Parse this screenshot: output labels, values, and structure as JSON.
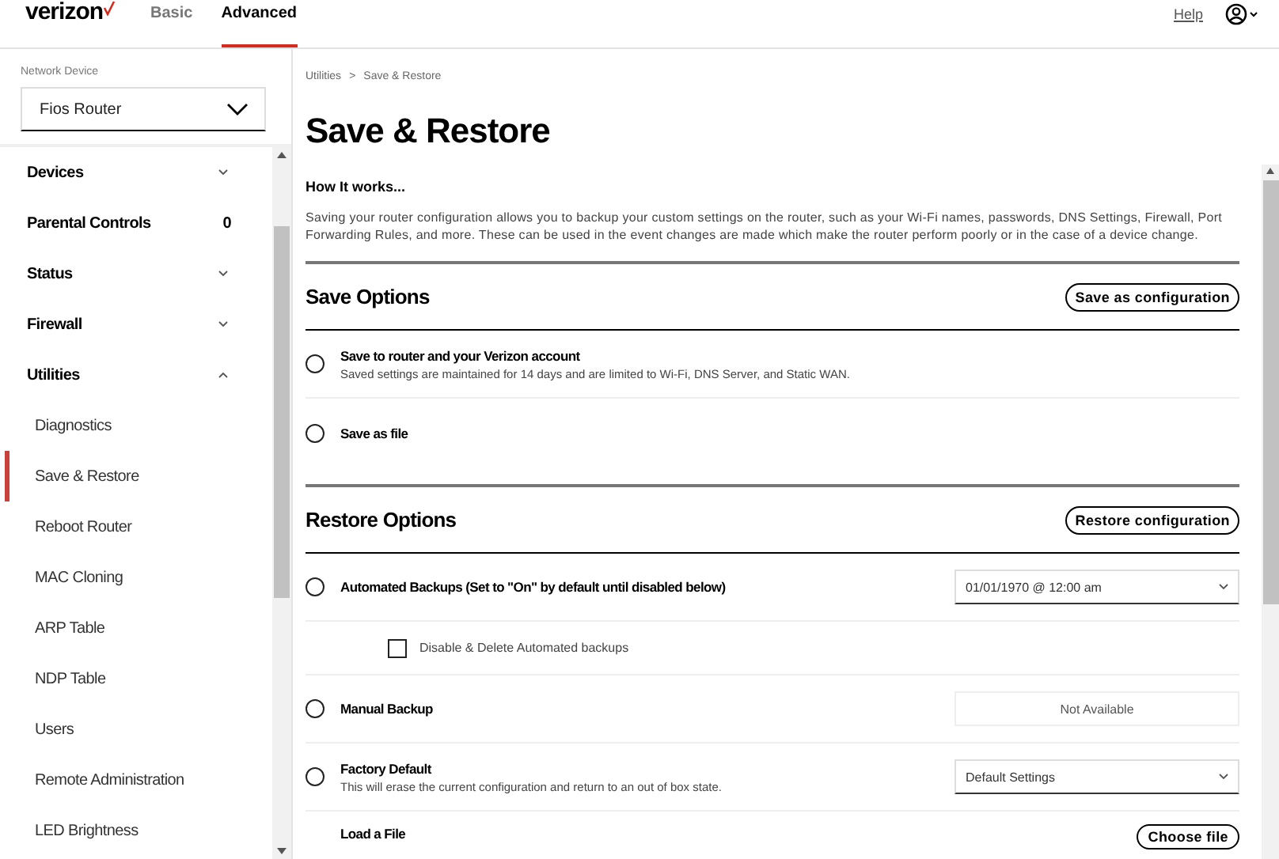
{
  "header": {
    "logo": "verizon",
    "tabs": [
      {
        "label": "Basic",
        "selected": false
      },
      {
        "label": "Advanced",
        "selected": true
      }
    ],
    "help_link": "Help"
  },
  "sidebar": {
    "device_label": "Network Device",
    "device_select": "Fios Router",
    "items": [
      {
        "label": "Devices",
        "kind": "group",
        "expanded": false
      },
      {
        "label": "Parental Controls",
        "kind": "badge",
        "badge": "0"
      },
      {
        "label": "Status",
        "kind": "group",
        "expanded": false
      },
      {
        "label": "Firewall",
        "kind": "group",
        "expanded": false
      },
      {
        "label": "Utilities",
        "kind": "group",
        "expanded": true,
        "children": [
          {
            "label": "Diagnostics",
            "selected": false
          },
          {
            "label": "Save & Restore",
            "selected": true
          },
          {
            "label": "Reboot Router",
            "selected": false
          },
          {
            "label": "MAC Cloning",
            "selected": false
          },
          {
            "label": "ARP Table",
            "selected": false
          },
          {
            "label": "NDP Table",
            "selected": false
          },
          {
            "label": "Users",
            "selected": false
          },
          {
            "label": "Remote Administration",
            "selected": false
          },
          {
            "label": "LED Brightness",
            "selected": false
          }
        ]
      }
    ]
  },
  "breadcrumb": {
    "items": [
      "Utilities",
      "Save & Restore"
    ],
    "separator": ">"
  },
  "title": "Save & Restore",
  "intro": {
    "heading": "How It works...",
    "text": "Saving your router configuration allows you to backup your custom settings on the router, such as your Wi-Fi names, passwords, DNS Settings, Firewall, Port Forwarding Rules, and more. These can be used in the event changes are made which make the router perform poorly or in the case of a device change."
  },
  "sections": [
    {
      "title": "Save Options",
      "button": "Save as configuration",
      "options": [
        {
          "kind": "radio",
          "label": "Save to router and your Verizon account",
          "description": "Saved settings are maintained for 14 days and are limited to Wi-Fi, DNS Server, and Static WAN.",
          "selected": false
        },
        {
          "kind": "radio",
          "label": "Save as file",
          "selected": false
        }
      ]
    },
    {
      "title": "Restore Options",
      "button": "Restore configuration",
      "options": [
        {
          "kind": "radio",
          "label": "Automated Backups (Set to \"On\" by default until disabled below)",
          "selected": false,
          "control": {
            "kind": "select",
            "value": "01/01/1970 @ 12:00 am"
          }
        },
        {
          "kind": "checkbox",
          "label": "Disable & Delete Automated backups",
          "checked": false
        },
        {
          "kind": "radio",
          "label": "Manual Backup",
          "selected": false,
          "control": {
            "kind": "disabled",
            "value": "Not Available"
          }
        },
        {
          "kind": "radio",
          "label": "Factory Default",
          "description": "This will erase the current configuration and return to an out of box state.",
          "selected": false,
          "control": {
            "kind": "select",
            "value": "Default Settings"
          }
        },
        {
          "kind": "file",
          "label": "Load a File",
          "control": {
            "kind": "button",
            "value": "Choose file"
          }
        }
      ]
    }
  ]
}
